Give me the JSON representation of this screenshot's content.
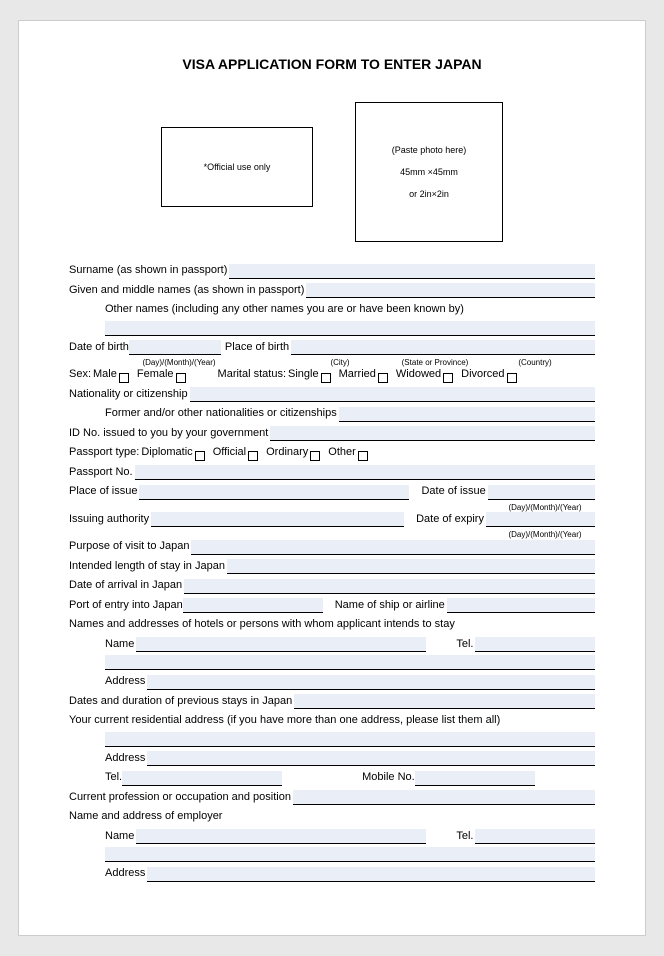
{
  "title": "VISA APPLICATION FORM TO ENTER JAPAN",
  "officialUse": "*Official use only",
  "photo": {
    "line1": "(Paste photo here)",
    "line2": "45mm ×45mm",
    "line3": "or 2in×2in"
  },
  "fields": {
    "surname": "Surname (as shown in passport)",
    "given": "Given and middle names (as shown in passport)",
    "otherNames": "Other names (including any other names you are or have been known by)",
    "dob": "Date of birth",
    "dobSub": "(Day)/(Month)/(Year)",
    "pob": "Place of birth",
    "city": "(City)",
    "stateProv": "(State or Province)",
    "country": "(Country)",
    "sex": "Sex:",
    "male": "Male",
    "female": "Female",
    "maritalStatus": "Marital status:",
    "single": "Single",
    "married": "Married",
    "widowed": "Widowed",
    "divorced": "Divorced",
    "nationality": "Nationality or citizenship",
    "formerNat": "Former and/or other nationalities or citizenships",
    "idNo": "ID No. issued to you by your government",
    "passportType": "Passport type:",
    "diplomatic": "Diplomatic",
    "official": "Official",
    "ordinary": "Ordinary",
    "other": "Other",
    "passportNo": "Passport No.",
    "placeIssue": "Place of issue",
    "dateIssue": "Date of issue",
    "dateSub": "(Day)/(Month)/(Year)",
    "issuingAuth": "Issuing authority",
    "dateExpiry": "Date of expiry",
    "purpose": "Purpose of visit to Japan",
    "intendedLength": "Intended length of stay in Japan",
    "dateArrival": "Date of arrival in Japan",
    "portEntry": "Port of entry into Japan",
    "shipAirline": "Name of ship or airline",
    "hotels": "Names and addresses of hotels or persons with whom applicant intends to stay",
    "name": "Name",
    "tel": "Tel.",
    "address": "Address",
    "prevStays": "Dates and duration of previous stays in Japan",
    "residential": "Your current residential address (if you have more than one address, please list them all)",
    "mobile": "Mobile No.",
    "profession": "Current profession or occupation and position",
    "employer": "Name and address of employer"
  }
}
